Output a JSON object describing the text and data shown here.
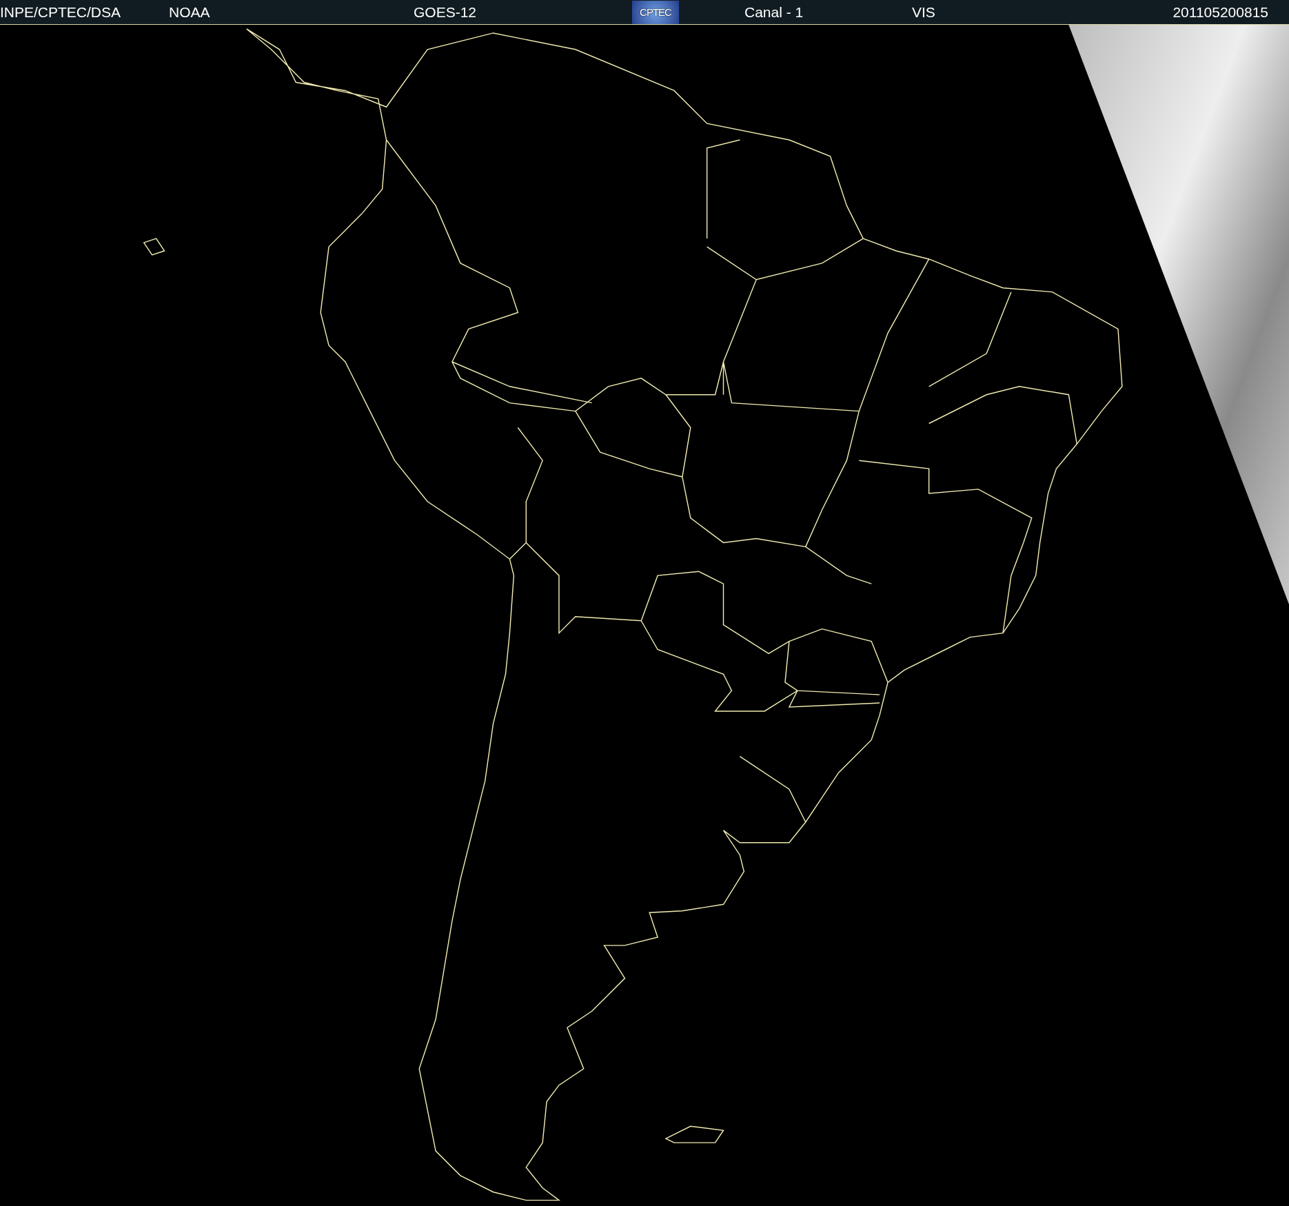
{
  "header": [
    {
      "kind": "text",
      "text": "INPE/CPTEC/DSA"
    },
    {
      "kind": "text",
      "text": "NOAA"
    },
    {
      "kind": "text",
      "text": "GOES-12"
    },
    {
      "kind": "logo",
      "text": "CPTEC"
    },
    {
      "kind": "text",
      "text": "Canal - 1"
    },
    {
      "kind": "text",
      "text": "VIS"
    },
    {
      "kind": "text",
      "text": "201105200815"
    }
  ]
}
